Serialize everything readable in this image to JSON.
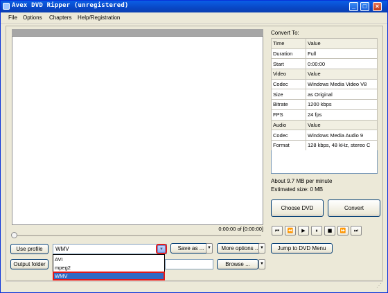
{
  "window": {
    "title": "Avex DVD Ripper (unregistered)",
    "controls": [
      "_",
      "□",
      "×"
    ]
  },
  "menu": [
    "File",
    "Options",
    "Chapters",
    "Help/Registration"
  ],
  "player": {
    "timecode": "0:00:00 of [0:00:00]"
  },
  "convert_to": {
    "label": "Convert To:",
    "rows": [
      {
        "name": "Time",
        "value": "Value",
        "header": true
      },
      {
        "name": "Duration",
        "value": "Full"
      },
      {
        "name": "Start",
        "value": "0:00:00"
      },
      {
        "name": "Video",
        "value": "Value",
        "header": true
      },
      {
        "name": "Codec",
        "value": "Windows Media Video V8"
      },
      {
        "name": "Size",
        "value": "as Original"
      },
      {
        "name": "Bitrate",
        "value": "1200 kbps"
      },
      {
        "name": "FPS",
        "value": "24 fps"
      },
      {
        "name": "Audio",
        "value": "Value",
        "header": true
      },
      {
        "name": "Codec",
        "value": "Windows Media Audio 9"
      },
      {
        "name": "Format",
        "value": "128 kbps, 48 kHz, stereo C"
      }
    ],
    "about": "About 9.7 MB per minute",
    "estimated_size": "Estimated size: 0 MB"
  },
  "buttons": {
    "choose_dvd": "Choose DVD",
    "convert": "Convert",
    "use_profile": "Use profile",
    "save_as": "Save as ...",
    "more_options": "More options ...",
    "jump_menu": "Jump to DVD Menu",
    "output_folder": "Output folder",
    "browse": "Browse ..."
  },
  "playback": [
    "⏮",
    "⏪",
    "▶",
    "⏸",
    "■",
    "⏩",
    "⏭"
  ],
  "profile": {
    "value": "WMV",
    "options": [
      "AVI",
      "mpeg2",
      "WMV"
    ],
    "selected_index": 2
  },
  "output_folder_value": ""
}
